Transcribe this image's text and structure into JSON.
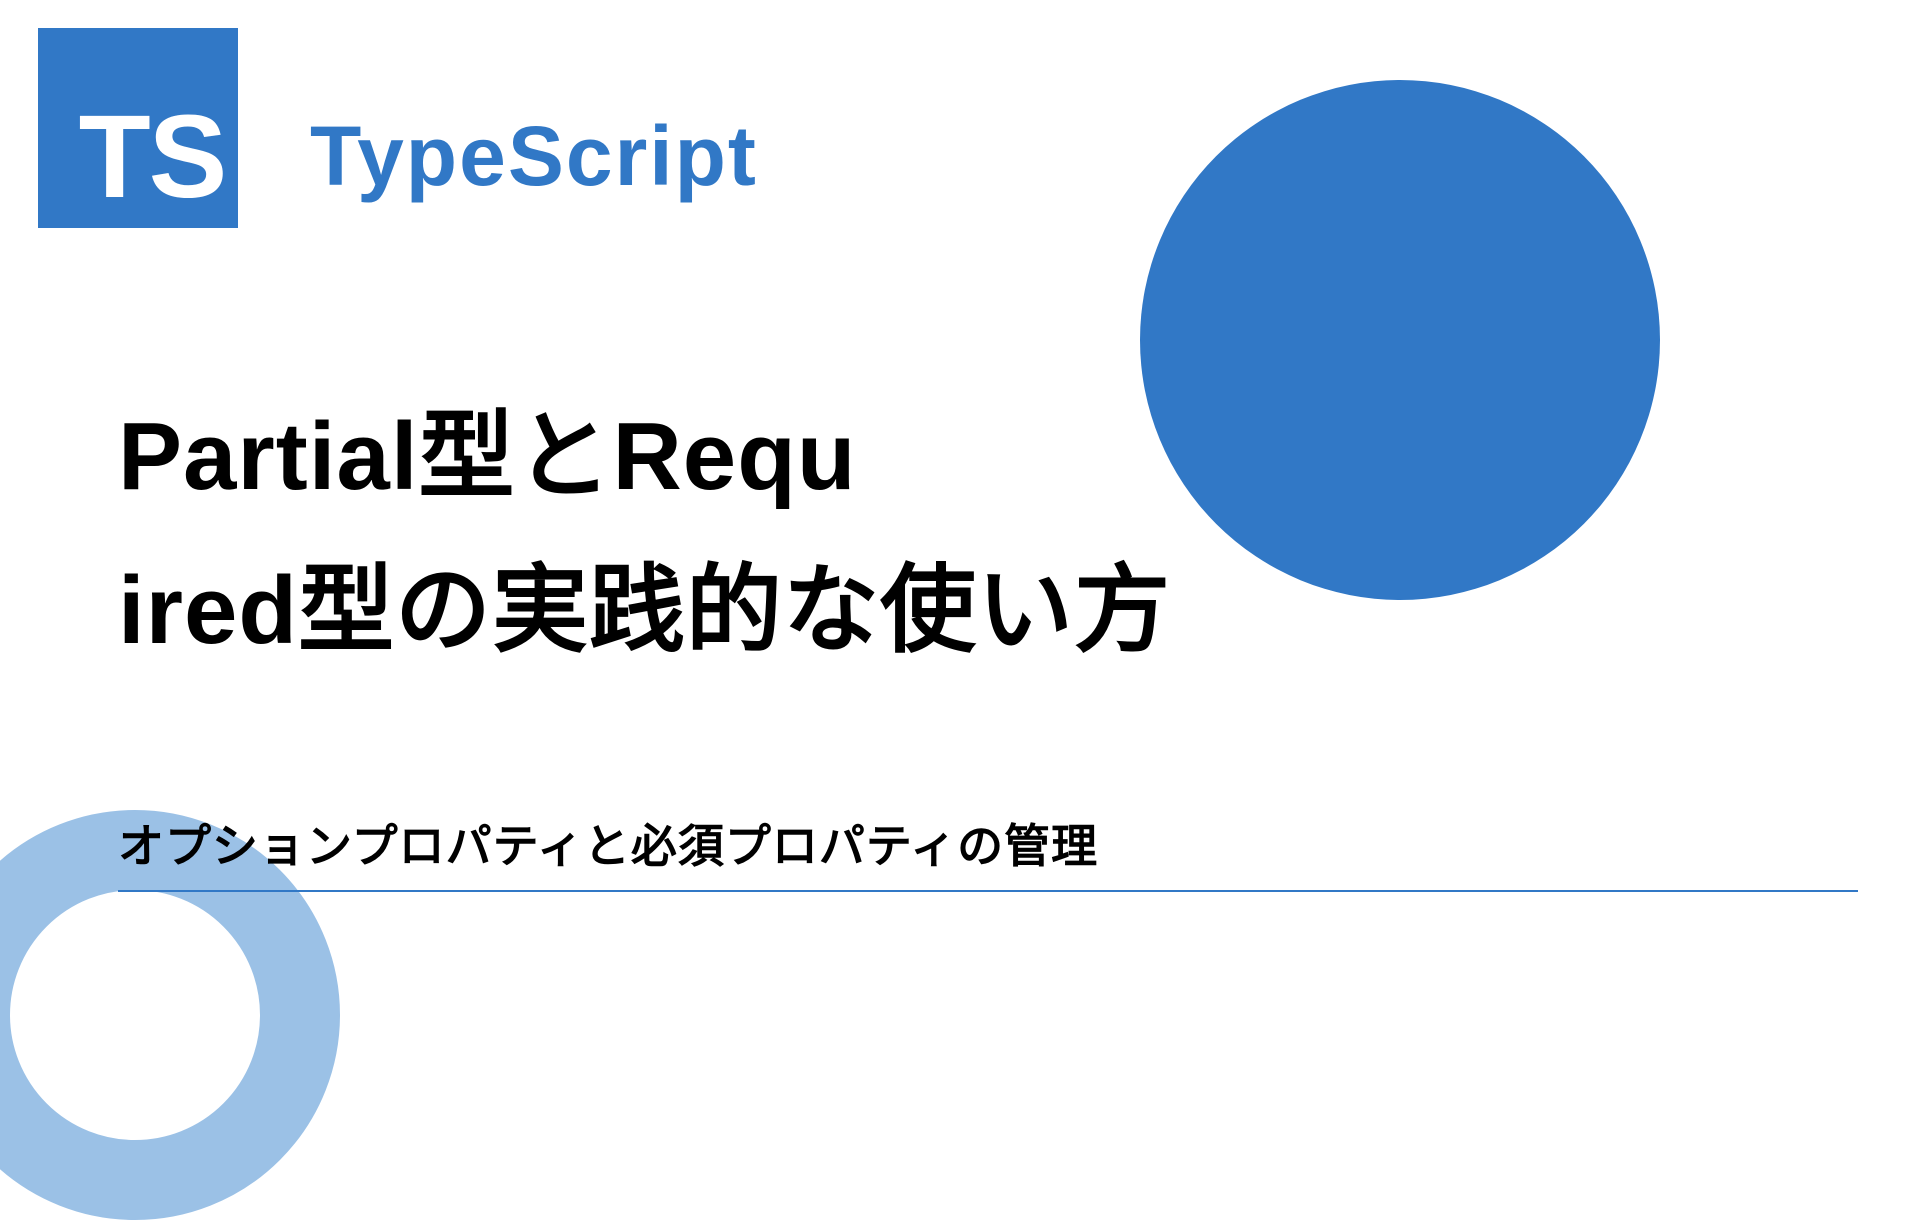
{
  "logo": {
    "text": "TS"
  },
  "header": {
    "language_label": "TypeScript"
  },
  "content": {
    "title": "Partial型とRequ\nired型の実践的な使い方",
    "subtitle": "オプションプロパティと必須プロパティの管理"
  },
  "colors": {
    "brand": "#3178c6",
    "ring": "#9bc1e6"
  }
}
